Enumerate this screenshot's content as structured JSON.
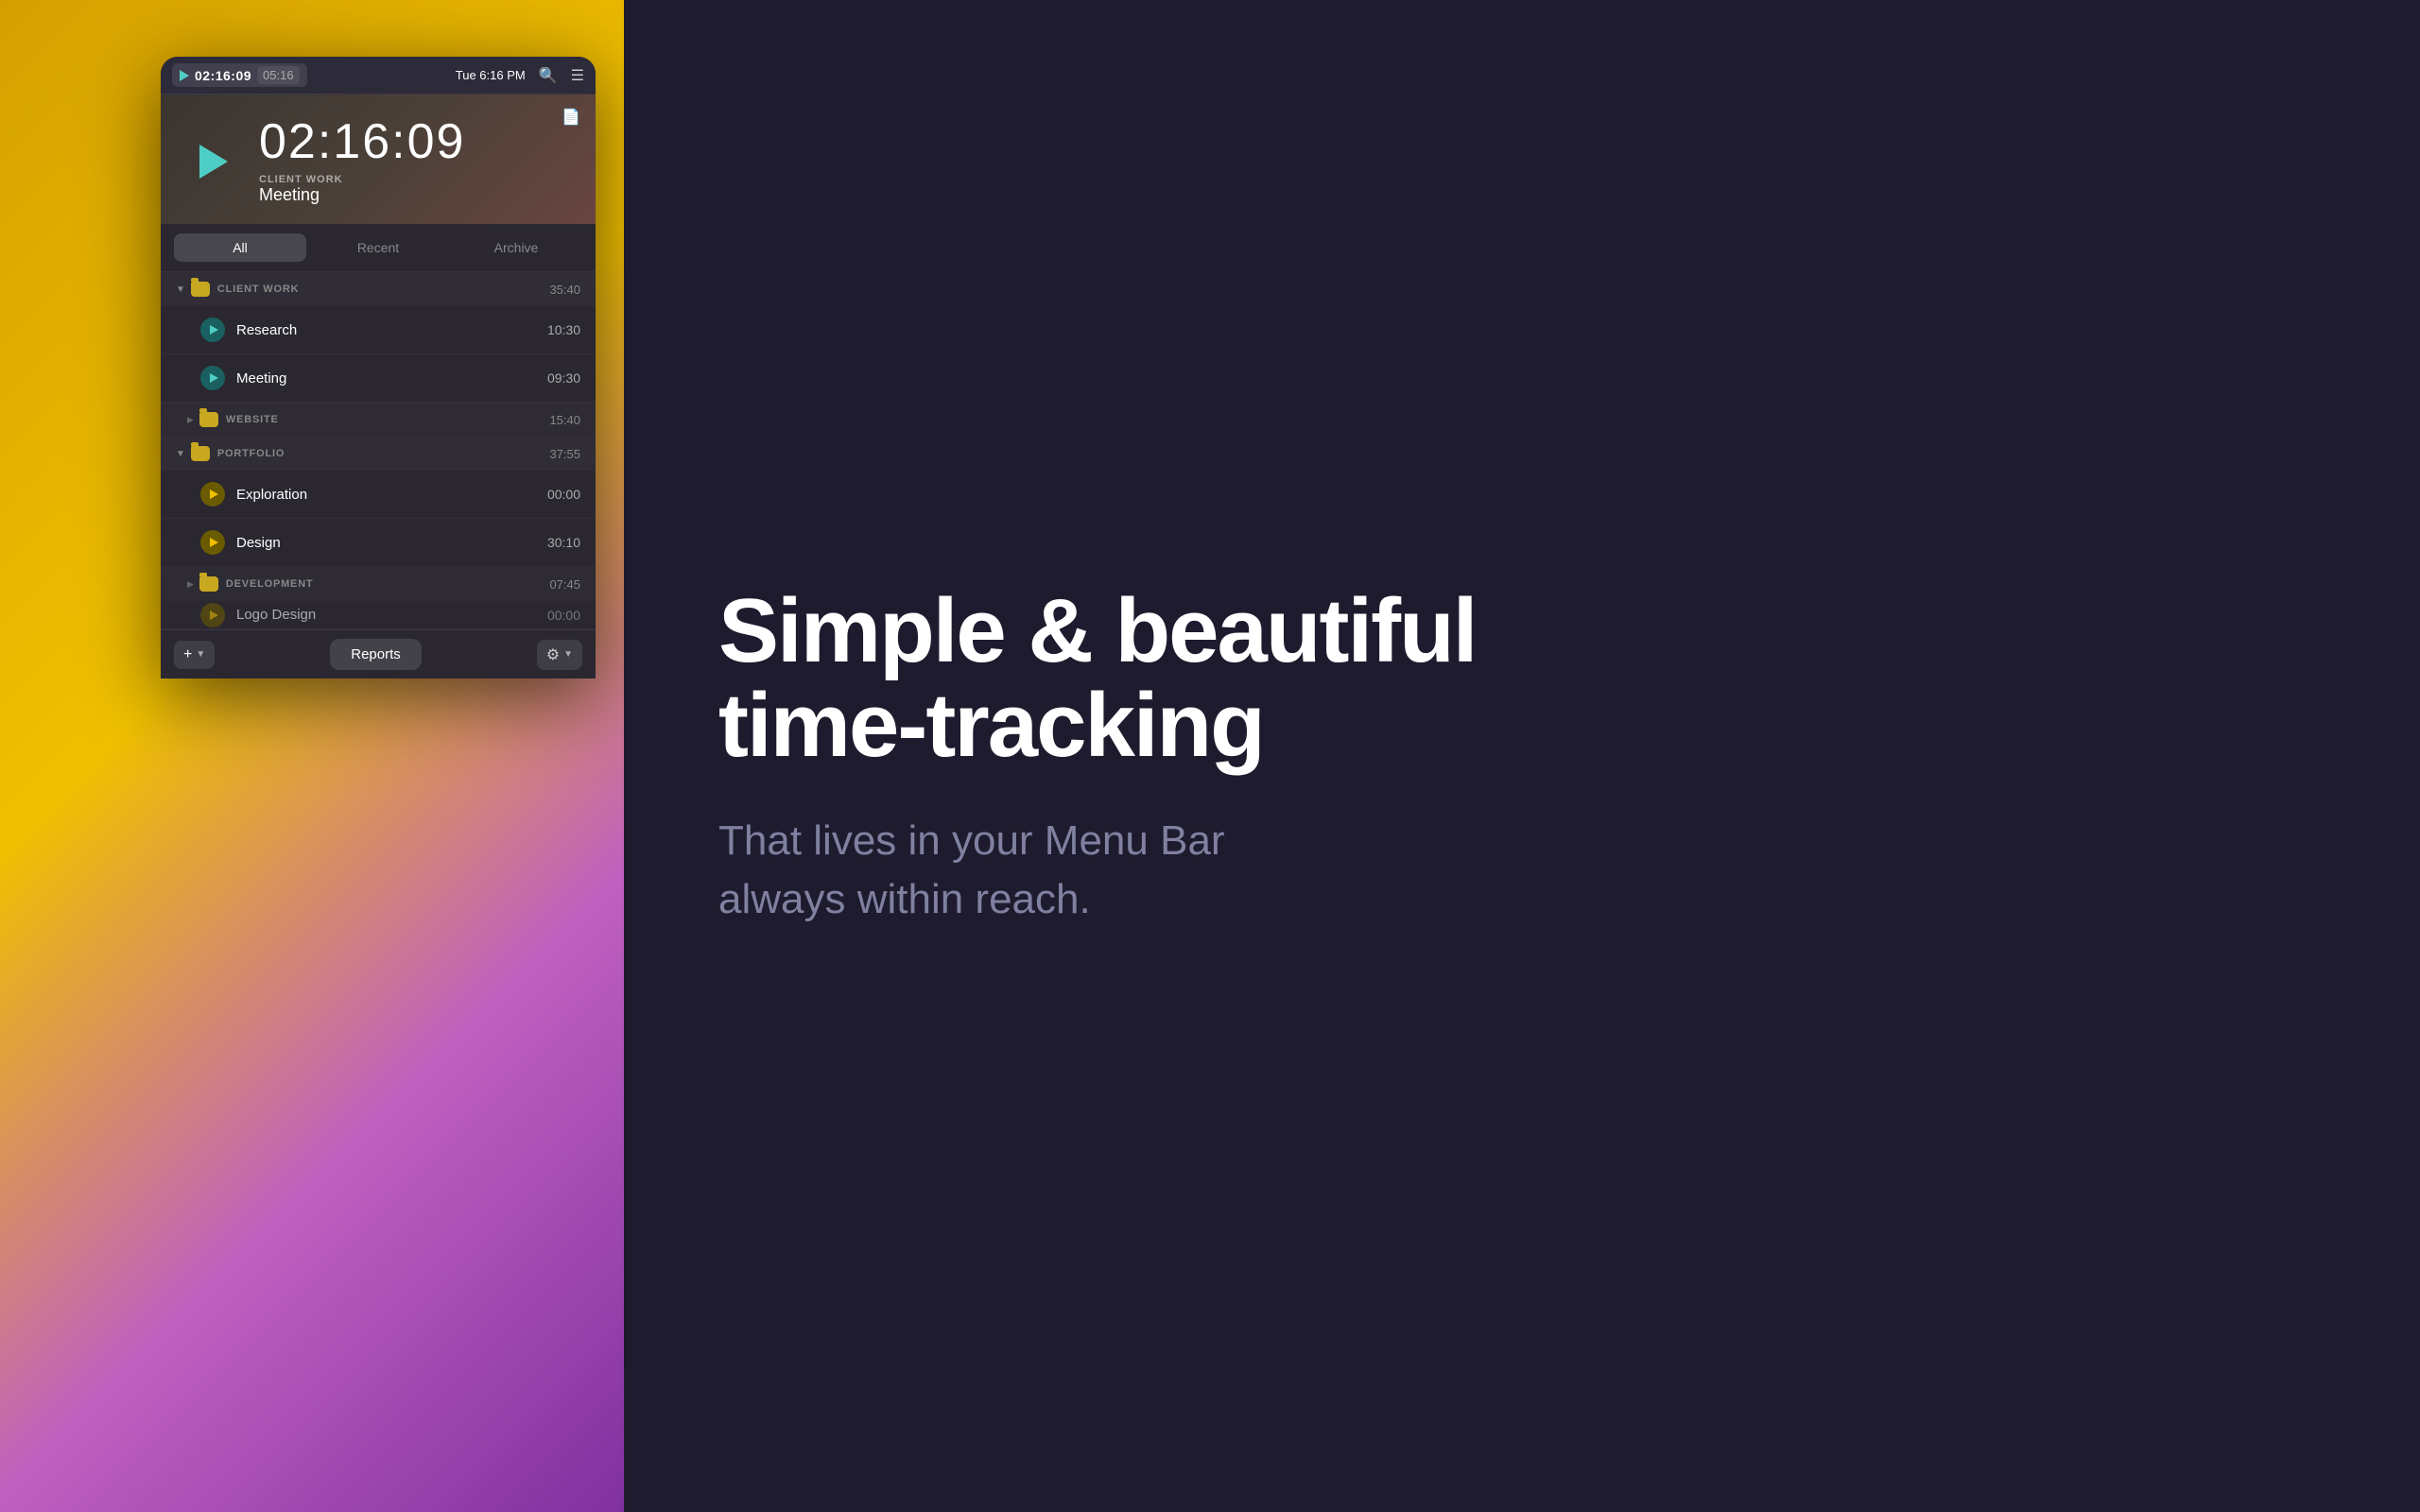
{
  "menubar": {
    "play_icon": "▶",
    "timer_primary": "02:16:09",
    "timer_secondary": "05:16",
    "date": "Tue 6:16 PM",
    "search_icon": "🔍",
    "list_icon": "☰"
  },
  "timer": {
    "time": "02:16:09",
    "project_label": "CLIENT WORK",
    "project_name": "Meeting"
  },
  "tabs": [
    {
      "label": "All",
      "active": true
    },
    {
      "label": "Recent",
      "active": false
    },
    {
      "label": "Archive",
      "active": false
    }
  ],
  "groups": [
    {
      "name": "CLIENT WORK",
      "time": "35:40",
      "expanded": true,
      "items": [
        {
          "name": "Research",
          "time": "10:30",
          "color": "teal"
        },
        {
          "name": "Meeting",
          "time": "09:30",
          "color": "teal"
        }
      ]
    },
    {
      "name": "WEBSITE",
      "time": "15:40",
      "expanded": false,
      "items": []
    },
    {
      "name": "PORTFOLIO",
      "time": "37:55",
      "expanded": true,
      "items": [
        {
          "name": "Exploration",
          "time": "00:00",
          "color": "yellow"
        },
        {
          "name": "Design",
          "time": "30:10",
          "color": "yellow"
        }
      ]
    },
    {
      "name": "DEVELOPMENT",
      "time": "07:45",
      "expanded": false,
      "items": [
        {
          "name": "Logo Design",
          "time": "00:00",
          "color": "yellow"
        }
      ]
    }
  ],
  "bottom_bar": {
    "add_label": "+",
    "reports_label": "Reports",
    "settings_icon": "⚙"
  },
  "right": {
    "headline_line1": "Simple & beautiful",
    "headline_line2": "time-tracking",
    "subheadline_line1": "That lives in your Menu Bar",
    "subheadline_line2": "always within reach."
  }
}
